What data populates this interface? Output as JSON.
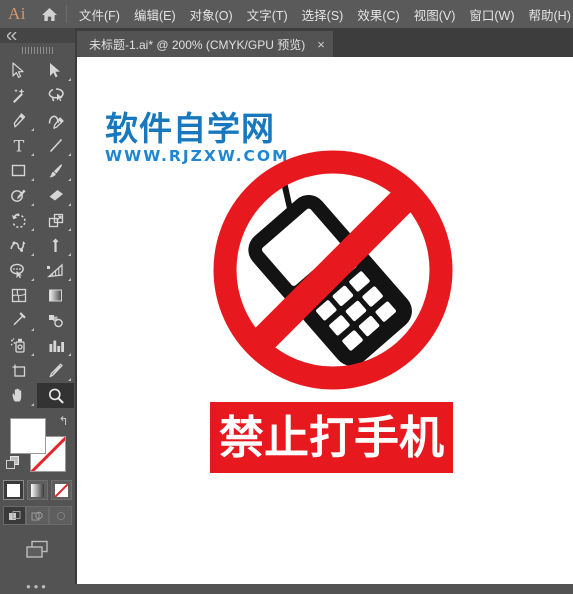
{
  "app": {
    "name": "Ai",
    "logo_color": "#d8976a",
    "home_icon": "home-icon"
  },
  "menubar": {
    "items": [
      {
        "label": "文件(F)"
      },
      {
        "label": "编辑(E)"
      },
      {
        "label": "对象(O)"
      },
      {
        "label": "文字(T)"
      },
      {
        "label": "选择(S)"
      },
      {
        "label": "效果(C)"
      },
      {
        "label": "视图(V)"
      },
      {
        "label": "窗口(W)"
      },
      {
        "label": "帮助(H)"
      }
    ]
  },
  "tabbar": {
    "tab_title": "未标题-1.ai* @ 200% (CMYK/GPU 预览)",
    "close_label": "×",
    "zoom_level": "200%",
    "color_mode": "CMYK",
    "preview_mode": "GPU 预览"
  },
  "toolpanel": {
    "collapse_label": "«",
    "tools": [
      {
        "name": "selection-tool",
        "has_corner": false
      },
      {
        "name": "direct-selection-tool",
        "has_corner": true
      },
      {
        "name": "magic-wand-tool",
        "has_corner": false
      },
      {
        "name": "lasso-tool",
        "has_corner": false
      },
      {
        "name": "pen-tool",
        "has_corner": true
      },
      {
        "name": "curvature-tool",
        "has_corner": false
      },
      {
        "name": "type-tool",
        "has_corner": true
      },
      {
        "name": "line-segment-tool",
        "has_corner": true
      },
      {
        "name": "rectangle-tool",
        "has_corner": true
      },
      {
        "name": "paintbrush-tool",
        "has_corner": true
      },
      {
        "name": "shaper-tool",
        "has_corner": true
      },
      {
        "name": "eraser-tool",
        "has_corner": true
      },
      {
        "name": "rotate-tool",
        "has_corner": true
      },
      {
        "name": "scale-tool",
        "has_corner": true
      },
      {
        "name": "width-tool",
        "has_corner": true
      },
      {
        "name": "free-transform-tool",
        "has_corner": true
      },
      {
        "name": "shape-builder-tool",
        "has_corner": true
      },
      {
        "name": "perspective-grid-tool",
        "has_corner": true
      },
      {
        "name": "mesh-tool",
        "has_corner": false
      },
      {
        "name": "gradient-tool",
        "has_corner": false
      },
      {
        "name": "eyedropper-tool",
        "has_corner": true
      },
      {
        "name": "blend-tool",
        "has_corner": false
      },
      {
        "name": "symbol-sprayer-tool",
        "has_corner": true
      },
      {
        "name": "column-graph-tool",
        "has_corner": true
      },
      {
        "name": "artboard-tool",
        "has_corner": false
      },
      {
        "name": "slice-tool",
        "has_corner": true
      },
      {
        "name": "hand-tool",
        "has_corner": true
      },
      {
        "name": "zoom-tool",
        "has_corner": false,
        "active": true
      }
    ],
    "colors": {
      "fill": "#ffffff",
      "stroke": "#ffffff",
      "stroke_none": true,
      "swap_label": "↰"
    },
    "mode_buttons": [
      {
        "name": "color-mode-button",
        "selected": true
      },
      {
        "name": "gradient-mode-button",
        "selected": false
      },
      {
        "name": "none-mode-button",
        "selected": false
      }
    ],
    "draw_buttons": [
      {
        "name": "draw-normal-button",
        "selected": true
      },
      {
        "name": "draw-behind-button",
        "selected": false
      },
      {
        "name": "draw-inside-button",
        "selected": false
      }
    ],
    "screen_mode": "change-screen-mode-button",
    "more_label": "•••"
  },
  "artwork": {
    "watermark": {
      "chinese": "软件自学网",
      "url": "WWW.RJZXW.COM",
      "color_chinese": "#1878be",
      "color_url": "#1f86cf"
    },
    "sign": {
      "name": "no-mobile-phone-sign",
      "ring_color": "#e8191e",
      "phone_color": "#131313",
      "description": "prohibition circle with slash over a mobile phone"
    },
    "banner": {
      "text": "禁止打手机",
      "background": "#e8191e",
      "text_color": "#ffffff"
    }
  }
}
